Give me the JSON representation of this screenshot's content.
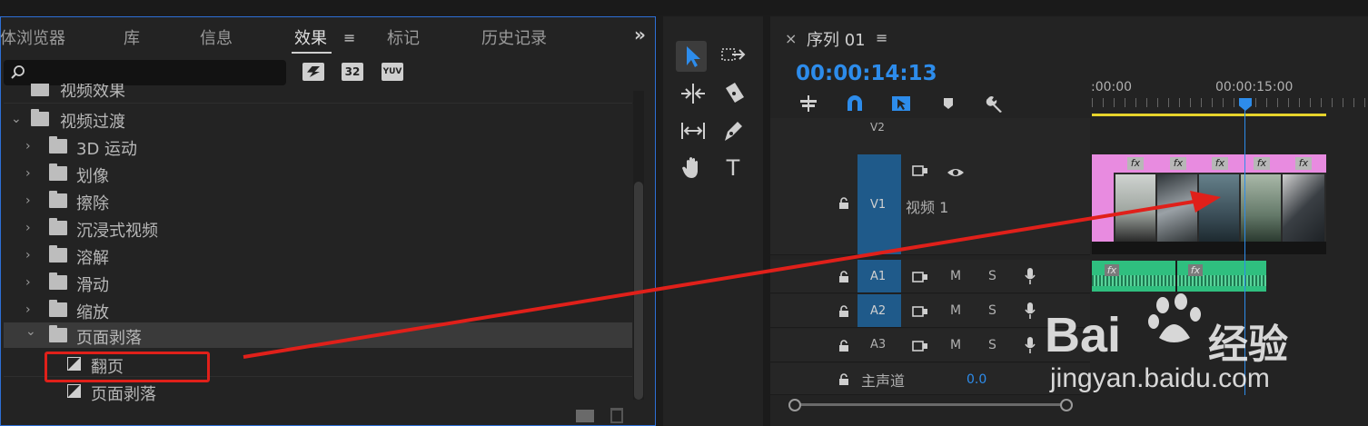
{
  "effects_panel": {
    "tabs": [
      {
        "label": "体浏览器"
      },
      {
        "label": "库"
      },
      {
        "label": "信息"
      },
      {
        "label": "效果"
      },
      {
        "label": "标记"
      },
      {
        "label": "历史记录"
      }
    ],
    "menu_glyph": "≡",
    "more_glyph": "»",
    "toolbar_icons": [
      "accelerated-effects-icon",
      "32bit-icon",
      "yuv-icon"
    ],
    "toolbar_texts": [
      "32",
      "YUV"
    ],
    "tree": [
      {
        "label": "视频效果",
        "level": 0,
        "expanded": false
      },
      {
        "label": "视频过渡",
        "level": 0,
        "expanded": true
      },
      {
        "label": "3D 运动",
        "level": 1,
        "expanded": false
      },
      {
        "label": "划像",
        "level": 1,
        "expanded": false
      },
      {
        "label": "擦除",
        "level": 1,
        "expanded": false
      },
      {
        "label": "沉浸式视频",
        "level": 1,
        "expanded": false
      },
      {
        "label": "溶解",
        "level": 1,
        "expanded": false
      },
      {
        "label": "滑动",
        "level": 1,
        "expanded": false
      },
      {
        "label": "缩放",
        "level": 1,
        "expanded": false
      },
      {
        "label": "页面剥落",
        "level": 1,
        "expanded": true
      },
      {
        "label": "翻页",
        "level": 2
      },
      {
        "label": "页面剥落",
        "level": 2
      }
    ]
  },
  "sequence": {
    "title": "序列 01",
    "close_glyph": "×",
    "menu_glyph": "≡",
    "timecode": "00:00:14:13",
    "ruler_labels": [
      ":00:00",
      "00:00:15:00"
    ],
    "tracks": {
      "v2": {
        "label": "V2"
      },
      "v1": {
        "label": "V1",
        "name": "视频 1"
      },
      "a1": {
        "label": "A1"
      },
      "a2": {
        "label": "A2"
      },
      "a3": {
        "label": "A3"
      },
      "master": {
        "label": "主声道",
        "value": "0.0"
      }
    },
    "mute_label": "M",
    "solo_label": "S",
    "fx_label": "fx"
  },
  "watermark": {
    "brand": "Bai",
    "brand2": "经验",
    "url": "jingyan.baidu.com"
  },
  "colors": {
    "accent_blue": "#2d8ceb",
    "highlight_red": "#e0201a",
    "clip_pink": "#e88be0",
    "audio_green": "#2fbf7f",
    "track_blue": "#1f5a8a"
  }
}
